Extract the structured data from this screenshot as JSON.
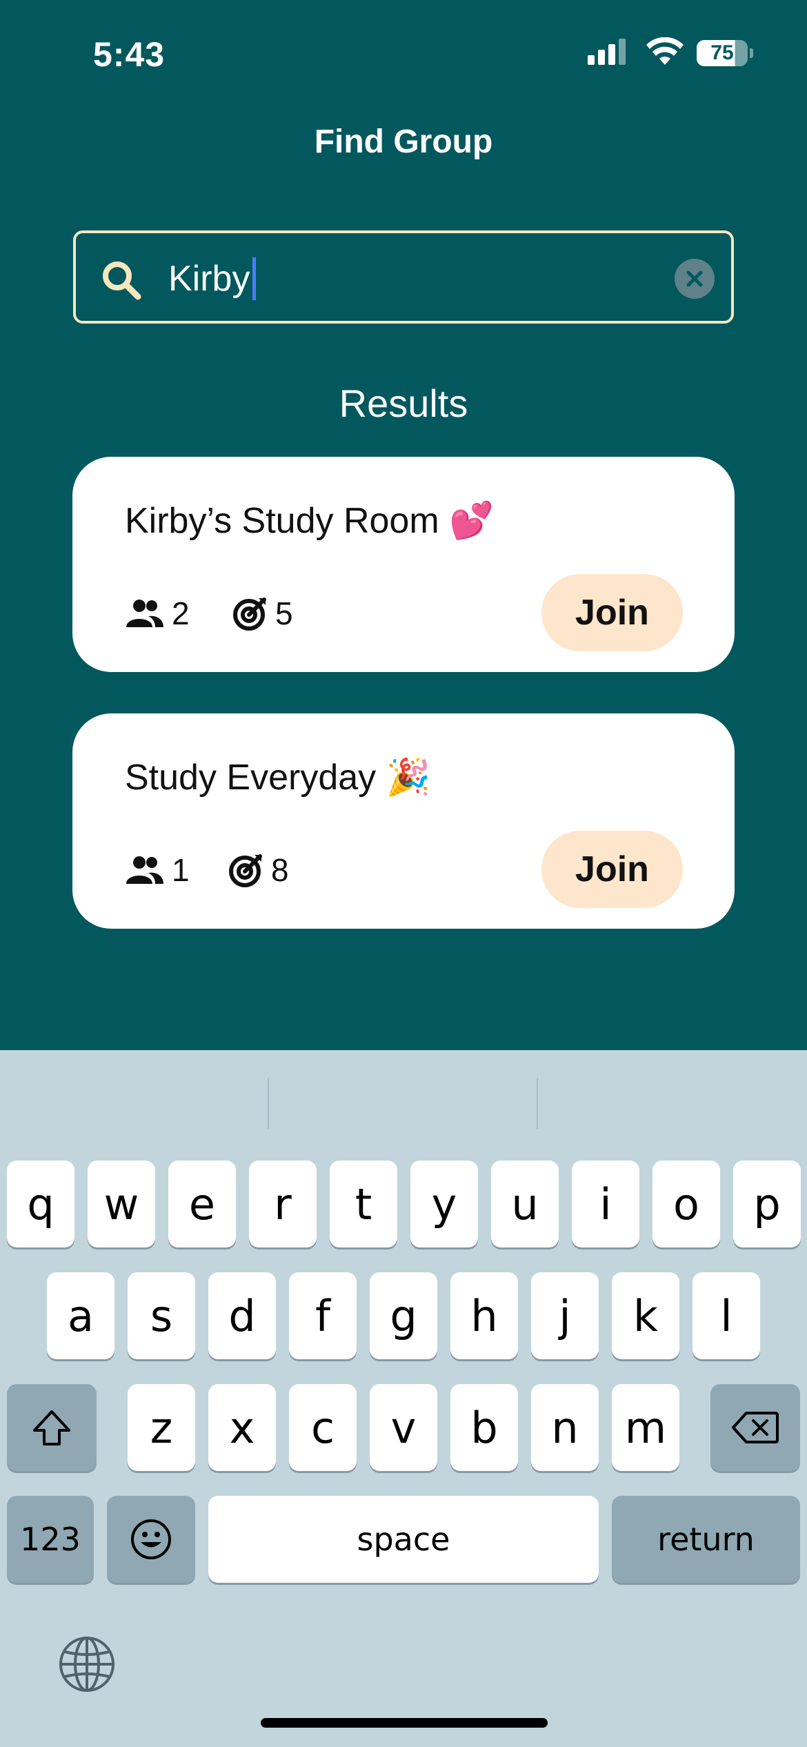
{
  "status_bar": {
    "time": "5:43",
    "battery": "75",
    "icons": [
      "cellular-signal-icon",
      "wifi-icon",
      "battery-icon"
    ]
  },
  "header": {
    "title": "Find Group"
  },
  "search": {
    "value": "Kirby",
    "clear_icon": "clear-icon",
    "search_icon": "search-icon"
  },
  "results": {
    "heading": "Results",
    "items": [
      {
        "title": "Kirby’s Study Room 💕",
        "members": "2",
        "goals": "5",
        "join_label": "Join"
      },
      {
        "title": "Study Everyday 🎉",
        "members": "1",
        "goals": "8",
        "join_label": "Join"
      }
    ]
  },
  "keyboard": {
    "row1": [
      "q",
      "w",
      "e",
      "r",
      "t",
      "y",
      "u",
      "i",
      "o",
      "p"
    ],
    "row2": [
      "a",
      "s",
      "d",
      "f",
      "g",
      "h",
      "j",
      "k",
      "l"
    ],
    "row3": [
      "z",
      "x",
      "c",
      "v",
      "b",
      "n",
      "m"
    ],
    "numbers_label": "123",
    "space_label": "space",
    "return_label": "return"
  },
  "colors": {
    "background": "#03585E",
    "search_border": "#F6E7BF",
    "join_button": "#FDE6CC",
    "keyboard_bg": "#C2D5DD"
  }
}
